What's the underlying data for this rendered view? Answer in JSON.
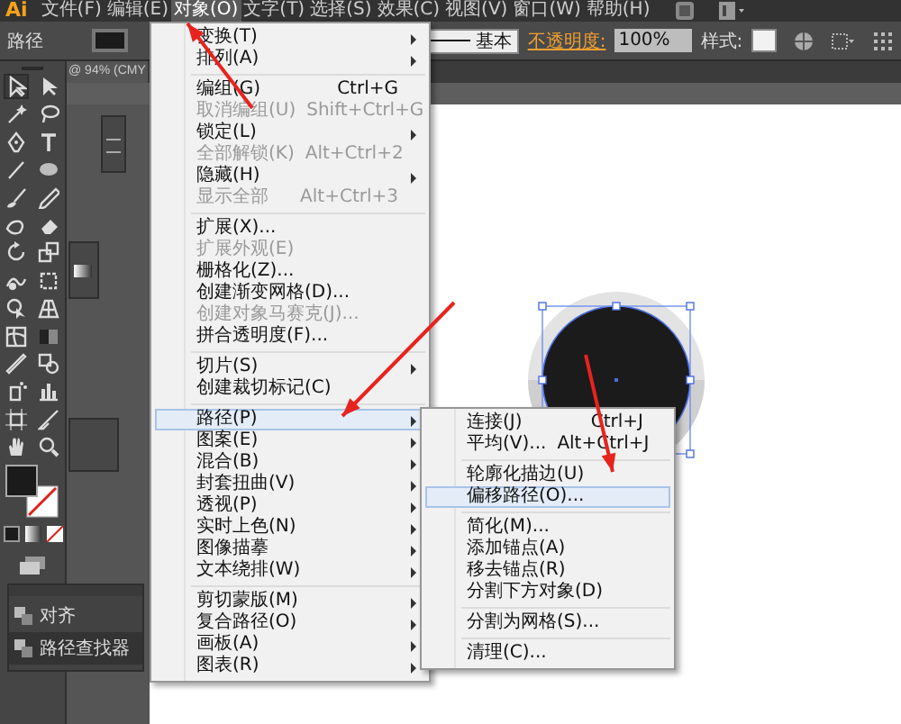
{
  "app": {
    "logo": "Ai"
  },
  "menubar": [
    {
      "label": "文件(F)",
      "selected": false
    },
    {
      "label": "编辑(E)",
      "selected": false
    },
    {
      "label": "对象(O)",
      "selected": true
    },
    {
      "label": "文字(T)",
      "selected": false
    },
    {
      "label": "选择(S)",
      "selected": false
    },
    {
      "label": "效果(C)",
      "selected": false
    },
    {
      "label": "视图(V)",
      "selected": false
    },
    {
      "label": "窗口(W)",
      "selected": false
    },
    {
      "label": "帮助(H)",
      "selected": false
    }
  ],
  "control_bar": {
    "object_type": "路径",
    "stroke_profile": "基本",
    "opacity_label": "不透明度:",
    "opacity": "100%",
    "style_label": "样式:"
  },
  "document_tab": {
    "title": "@ 94% (CMY"
  },
  "object_menu": {
    "sections": [
      [
        {
          "label": "变换(T)",
          "submenu": true,
          "disabled": false,
          "selected": false
        },
        {
          "label": "排列(A)",
          "submenu": true,
          "disabled": false,
          "selected": false
        }
      ],
      [
        {
          "label": "编组(G)",
          "shortcut": "Ctrl+G",
          "submenu": false,
          "disabled": false,
          "selected": false
        },
        {
          "label": "取消编组(U)",
          "shortcut": "Shift+Ctrl+G",
          "submenu": false,
          "disabled": true,
          "selected": false
        },
        {
          "label": "锁定(L)",
          "submenu": true,
          "disabled": false,
          "selected": false
        },
        {
          "label": "全部解锁(K)",
          "shortcut": "Alt+Ctrl+2",
          "submenu": false,
          "disabled": true,
          "selected": false
        },
        {
          "label": "隐藏(H)",
          "submenu": true,
          "disabled": false,
          "selected": false
        },
        {
          "label": "显示全部",
          "shortcut": "Alt+Ctrl+3",
          "submenu": false,
          "disabled": true,
          "selected": false
        }
      ],
      [
        {
          "label": "扩展(X)...",
          "submenu": false,
          "disabled": false,
          "selected": false
        },
        {
          "label": "扩展外观(E)",
          "submenu": false,
          "disabled": true,
          "selected": false
        },
        {
          "label": "栅格化(Z)...",
          "submenu": false,
          "disabled": false,
          "selected": false
        },
        {
          "label": "创建渐变网格(D)...",
          "submenu": false,
          "disabled": false,
          "selected": false
        },
        {
          "label": "创建对象马赛克(J)...",
          "submenu": false,
          "disabled": true,
          "selected": false
        },
        {
          "label": "拼合透明度(F)...",
          "submenu": false,
          "disabled": false,
          "selected": false
        }
      ],
      [
        {
          "label": "切片(S)",
          "submenu": true,
          "disabled": false,
          "selected": false
        },
        {
          "label": "创建裁切标记(C)",
          "submenu": false,
          "disabled": false,
          "selected": false
        }
      ],
      [
        {
          "label": "路径(P)",
          "submenu": true,
          "disabled": false,
          "selected": true
        },
        {
          "label": "图案(E)",
          "submenu": true,
          "disabled": false,
          "selected": false
        },
        {
          "label": "混合(B)",
          "submenu": true,
          "disabled": false,
          "selected": false
        },
        {
          "label": "封套扭曲(V)",
          "submenu": true,
          "disabled": false,
          "selected": false
        },
        {
          "label": "透视(P)",
          "submenu": true,
          "disabled": false,
          "selected": false
        },
        {
          "label": "实时上色(N)",
          "submenu": true,
          "disabled": false,
          "selected": false
        },
        {
          "label": "图像描摹",
          "submenu": true,
          "disabled": false,
          "selected": false
        },
        {
          "label": "文本绕排(W)",
          "submenu": true,
          "disabled": false,
          "selected": false
        }
      ],
      [
        {
          "label": "剪切蒙版(M)",
          "submenu": true,
          "disabled": false,
          "selected": false
        },
        {
          "label": "复合路径(O)",
          "submenu": true,
          "disabled": false,
          "selected": false
        },
        {
          "label": "画板(A)",
          "submenu": true,
          "disabled": false,
          "selected": false
        },
        {
          "label": "图表(R)",
          "submenu": true,
          "disabled": false,
          "selected": false
        }
      ]
    ]
  },
  "path_submenu": {
    "sections": [
      [
        {
          "label": "连接(J)",
          "shortcut": "Ctrl+J",
          "disabled": false,
          "selected": false
        },
        {
          "label": "平均(V)...",
          "shortcut": "Alt+Ctrl+J",
          "disabled": false,
          "selected": false
        }
      ],
      [
        {
          "label": "轮廓化描边(U)",
          "disabled": false,
          "selected": false
        },
        {
          "label": "偏移路径(O)...",
          "disabled": false,
          "selected": true
        }
      ],
      [
        {
          "label": "简化(M)...",
          "disabled": false,
          "selected": false
        },
        {
          "label": "添加锚点(A)",
          "disabled": false,
          "selected": false
        },
        {
          "label": "移去锚点(R)",
          "disabled": false,
          "selected": false
        },
        {
          "label": "分割下方对象(D)",
          "disabled": false,
          "selected": false
        }
      ],
      [
        {
          "label": "分割为网格(S)...",
          "disabled": false,
          "selected": false
        }
      ],
      [
        {
          "label": "清理(C)...",
          "disabled": false,
          "selected": false
        }
      ]
    ]
  },
  "panels": [
    {
      "label": "对齐",
      "selected": false
    },
    {
      "label": "路径查找器",
      "selected": true
    }
  ]
}
